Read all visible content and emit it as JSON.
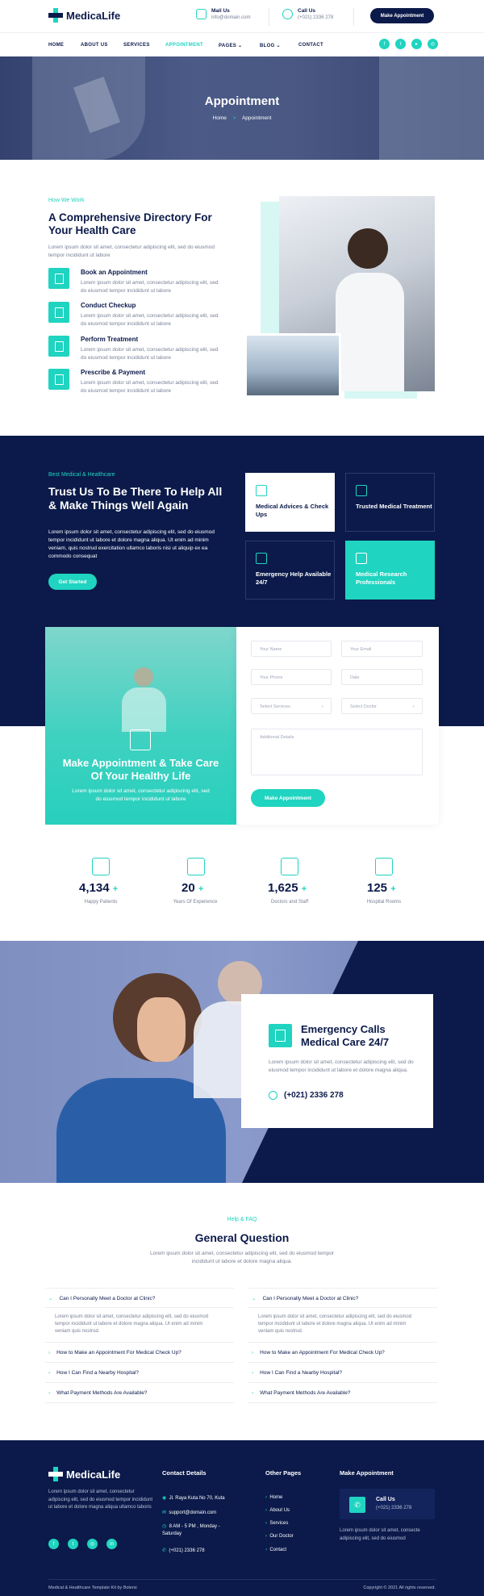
{
  "brand": {
    "name": "MedicaLife"
  },
  "topbar": {
    "mail_title": "Mail Us",
    "mail_value": "info@domain.com",
    "call_title": "Call Us",
    "call_value": "(+021) 2336 278",
    "cta": "Make Appointment"
  },
  "nav": {
    "items": [
      "HOME",
      "ABOUT US",
      "SERVICES",
      "APPOINTMENT",
      "PAGES",
      "BLOG",
      "CONTACT"
    ],
    "active": "APPOINTMENT"
  },
  "social": [
    "facebook-icon",
    "twitter-icon",
    "youtube-icon",
    "instagram-icon"
  ],
  "banner": {
    "title": "Appointment",
    "crumb_home": "Home",
    "crumb_sep": ">",
    "crumb_current": "Appointment"
  },
  "how": {
    "label": "How We Work",
    "title": "A Comprehensive Directory For Your Health Care",
    "text": "Lorem ipsum dolor sit amet, consectetur adipiscing elit, sed do eiusmod tempor incididunt ut labore",
    "steps": [
      {
        "title": "Book an Appointment",
        "text": "Lorem ipsum dolor sit amet, consectetur adipiscing elit, sed do eiusmod tempor incididunt ut labore"
      },
      {
        "title": "Conduct Checkup",
        "text": "Lorem ipsum dolor sit amet, consectetur adipiscing elit, sed do eiusmod tempor incididunt ut labore"
      },
      {
        "title": "Perform Treatment",
        "text": "Lorem ipsum dolor sit amet, consectetur adipiscing elit, sed do eiusmod tempor incididunt ut labore"
      },
      {
        "title": "Prescribe & Payment",
        "text": "Lorem ipsum dolor sit amet, consectetur adipiscing elit, sed do eiusmod tempor incididunt ut labore"
      }
    ]
  },
  "trust": {
    "label": "Best Medical & Healthcare",
    "title": "Trust Us To Be There To Help All & Make Things Well Again",
    "text": "Lorem ipsum dolor sit amet, consectetur adipiscing elit, sed do eiusmod tempor incididunt ut labore et dolore magna aliqua. Ut enim ad minim veniam, quis nostrud exercitation ullamco laboris nisi ut aliquip ex ea commodo consequat",
    "button": "Get Started",
    "cards": [
      "Medical Advices & Check Ups",
      "Trusted Medical Treatment",
      "Emergency Help Available 24/7",
      "Medical Research Professionals"
    ]
  },
  "appointment": {
    "title": "Make Appointment & Take Care Of Your Healthy Life",
    "text": "Lorem ipsum dolor sit amet, consectetur adipiscing elit, sed do eiusmod tempor incididunt ut labore",
    "name_ph": "Your Name",
    "email_ph": "Your Email",
    "phone_ph": "Your Phone",
    "date_ph": "Date",
    "services_ph": "Select Services",
    "doctor_ph": "Select Doctor",
    "details_ph": "Additional Details",
    "submit": "Make Appointment"
  },
  "stats": [
    {
      "number": "4,134",
      "label": "Happy Patients"
    },
    {
      "number": "20",
      "label": "Years Of Experience"
    },
    {
      "number": "1,625",
      "label": "Doctors and Staff"
    },
    {
      "number": "125",
      "label": "Hospital Rooms"
    }
  ],
  "stat_plus": "+",
  "emergency": {
    "title": "Emergency Calls Medical Care 24/7",
    "text": "Lorem ipsum dolor sit amet, consectetur adipiscing elit, sed do eiusmod tempor incididunt ut labore et dolore magna aliqua.",
    "phone": "(+021) 2336 278"
  },
  "faq": {
    "label": "Help & FAQ",
    "title": "General Question",
    "text": "Lorem ipsum dolor sit amet, consectetur adipiscing elit, sed do eiusmod tempor incididunt ut labore et dolore magna aliqua.",
    "open_q": "Can I Personally Meet a Doctor at Clinic?",
    "answer": "Lorem ipsum dolor sit amet, consectetur adipiscing elit, sed do eiusmod tempor incididunt ut labore et dolore magna aliqua. Ut enim ad minim veniam quis nostrud.",
    "questions": [
      "How to Make an Appointment For Medical Check Up?",
      "How I Can Find a Nearby Hospital?",
      "What Payment Methods Are Available?"
    ]
  },
  "footer": {
    "about": "Lorem ipsum dolor sit amet, consectetur adipiscing elit, sed do eiusmod tempor incididunt ut labore et dolore magna aliqua ullamco laboris",
    "contact_title": "Contact Details",
    "address": "Jl. Raya Kuta No 70, Kuta",
    "email": "support@domain.com",
    "hours": "8 AM - 5 PM , Monday - Saturday",
    "phone": "(+021) 2336 278",
    "pages_title": "Other Pages",
    "pages": [
      "Home",
      "About Us",
      "Services",
      "Our Doctor",
      "Contact"
    ],
    "appt_title": "Make Appointment",
    "call_title": "Call Us",
    "call_value": "(+021) 2336 278",
    "appt_text": "Lorem ipsum dolor sit amet, consecte adipiscing elit, sed do eiusmod",
    "copyright_left": "Medical & Healthcare Template Kit by Bolersi",
    "copyright_right": "Copyright © 2021 All rights reserved."
  },
  "colors": {
    "navy": "#0b1a4a",
    "teal": "#1fd4c0"
  }
}
